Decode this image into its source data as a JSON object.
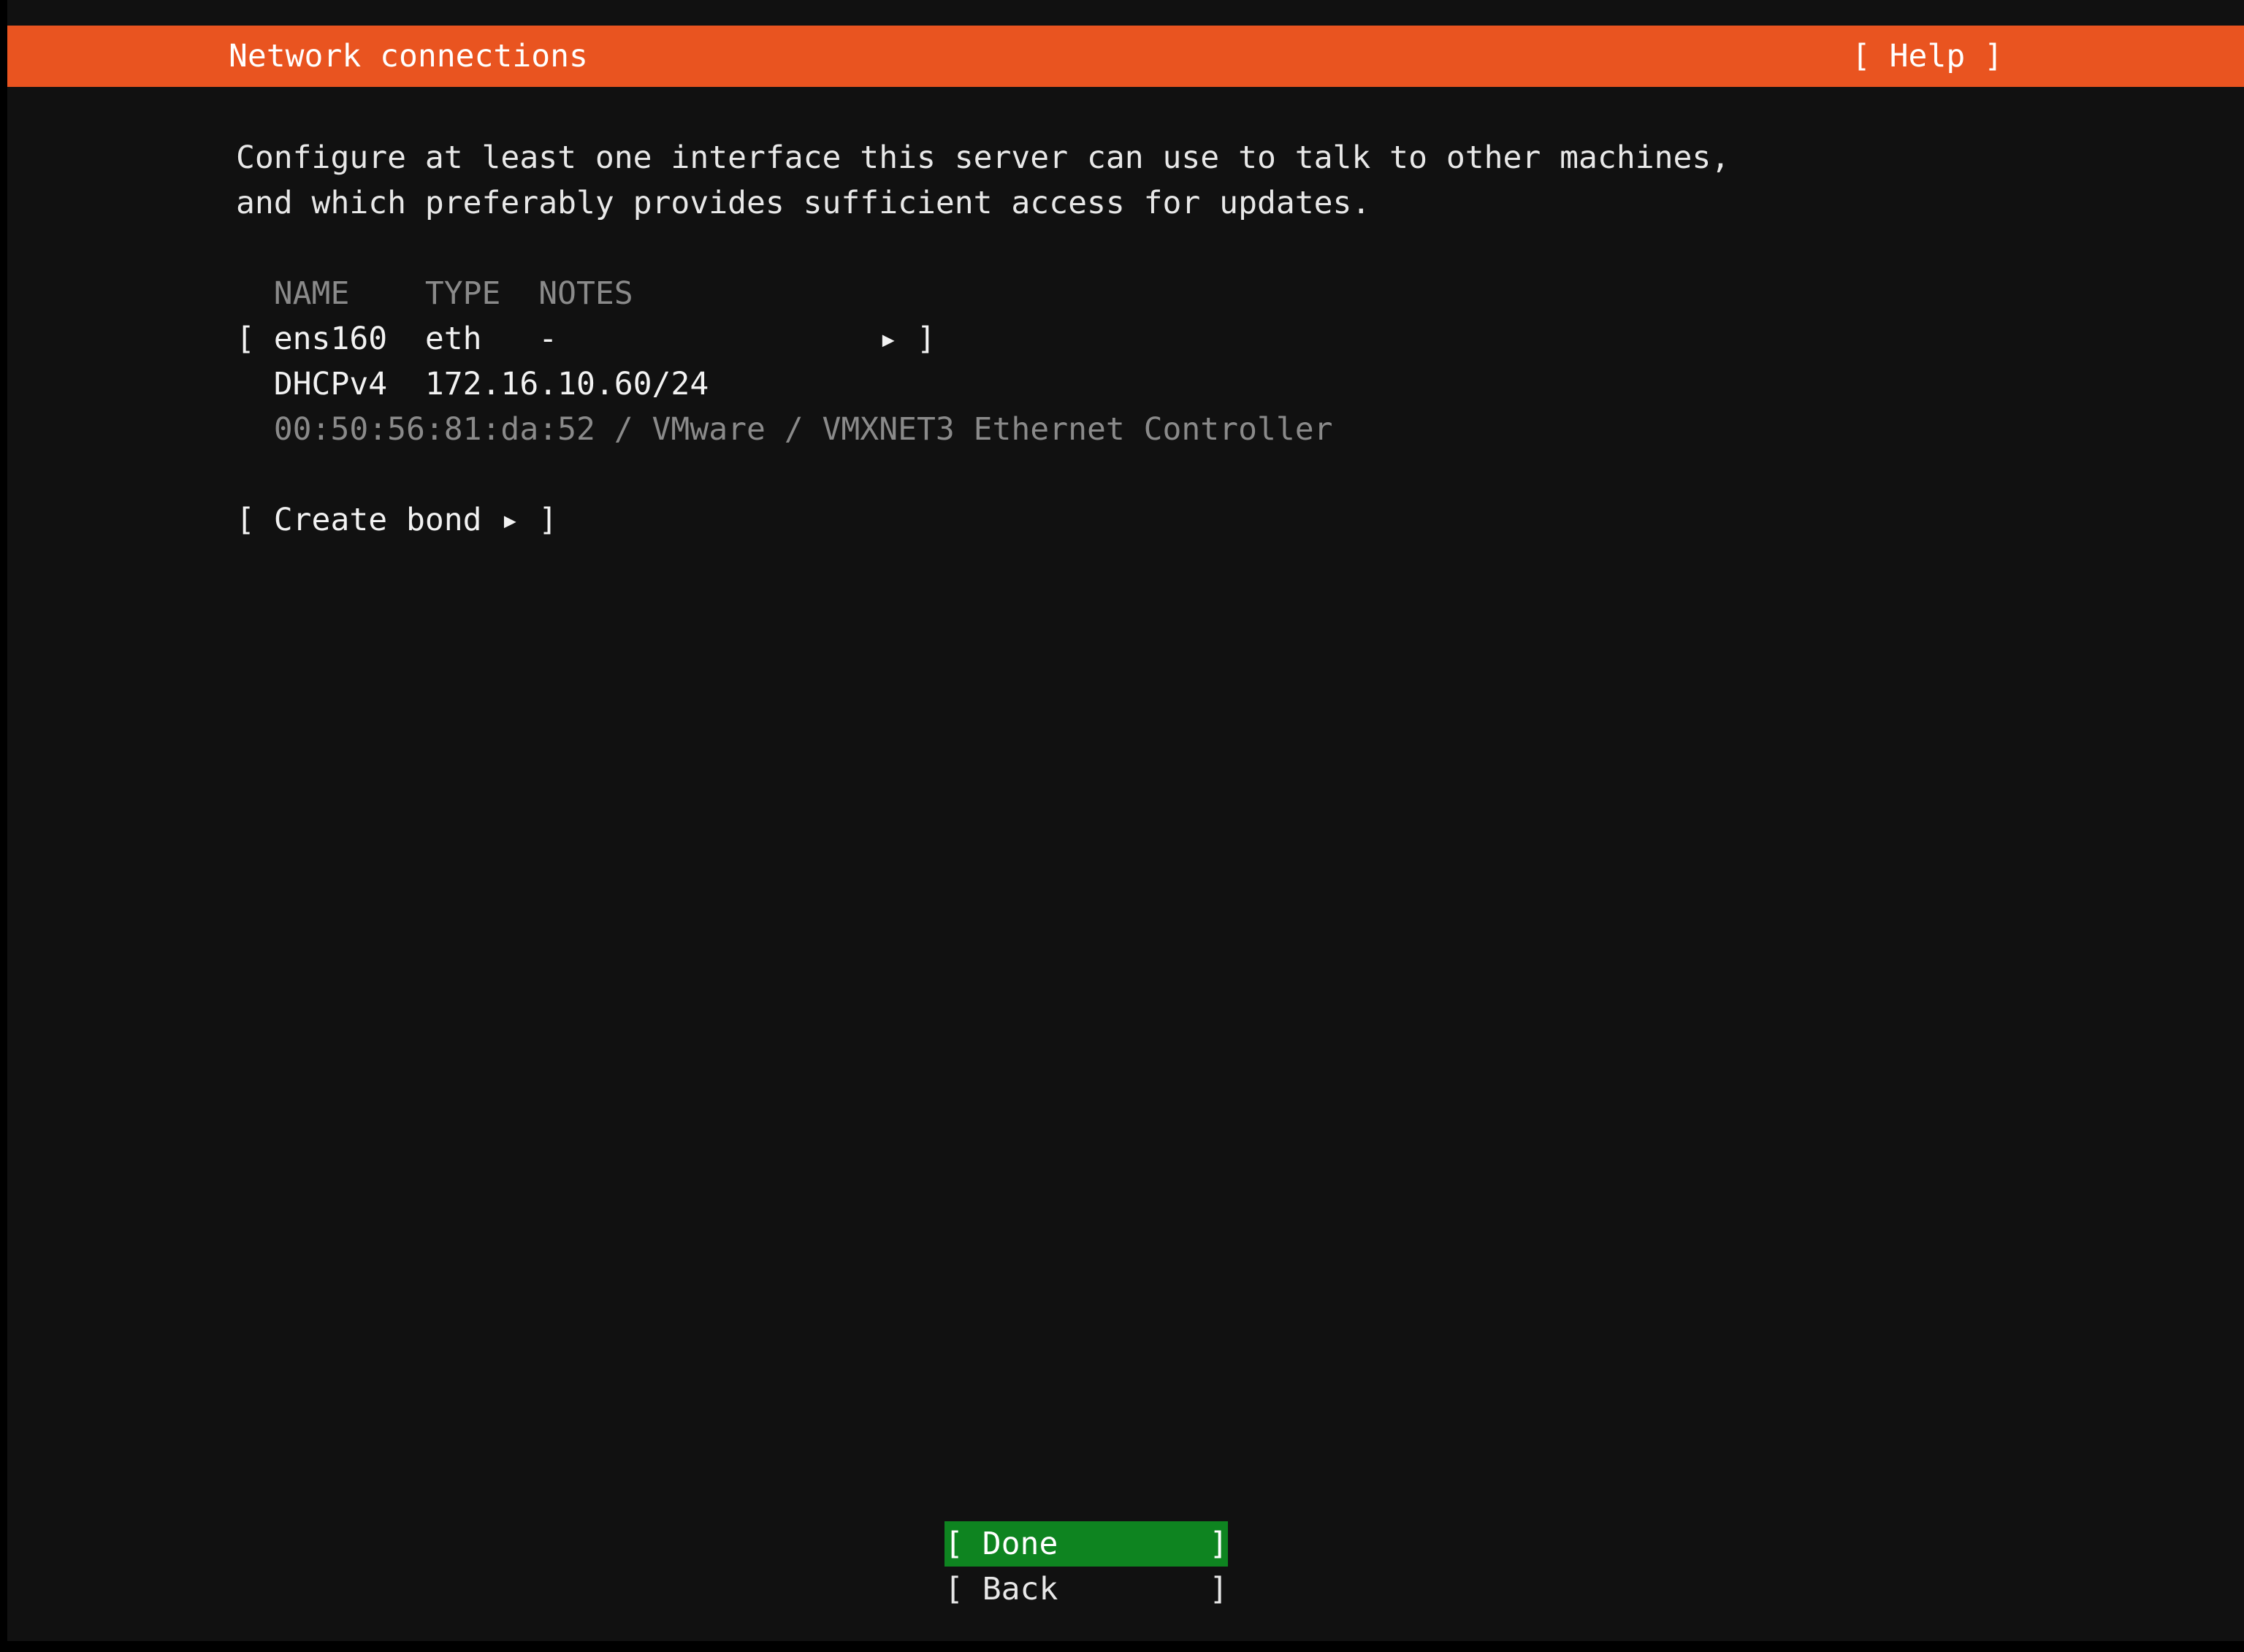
{
  "window": {
    "title": "Network connections",
    "help_label": "[ Help ]",
    "header_color": "#e95420",
    "background_color": "#111111",
    "text_color": "#e8e8e8",
    "dim_text_color": "#8a8a8a",
    "highlight_color": "#0e8420"
  },
  "description": {
    "line1": "Configure at least one interface this server can use to talk to other machines,",
    "line2": "and which preferably provides sufficient access for updates."
  },
  "table": {
    "headers": {
      "name": "NAME",
      "type": "TYPE",
      "notes": "NOTES"
    },
    "header_row_text": "  NAME    TYPE  NOTES",
    "rows": [
      {
        "selector_open": "[",
        "name": "ens160",
        "type": "eth",
        "notes": "-",
        "arrow": "▸",
        "selector_close": "]",
        "row_text": "[ ens160  eth   -                 ▸ ]",
        "detail_lines": [
          {
            "text": "  DHCPv4  172.16.10.60/24",
            "style": "bright",
            "protocol": "DHCPv4",
            "address": "172.16.10.60/24"
          },
          {
            "text": "  00:50:56:81:da:52 / VMware / VMXNET3 Ethernet Controller",
            "style": "dim",
            "mac": "00:50:56:81:da:52",
            "vendor": "VMware",
            "model": "VMXNET3 Ethernet Controller"
          }
        ]
      }
    ]
  },
  "actions": {
    "create_bond": "[ Create bond ▸ ]",
    "create_bond_label": "Create bond"
  },
  "buttons": {
    "done": "[ Done        ]",
    "done_label": "Done",
    "back": "[ Back        ]",
    "back_label": "Back"
  }
}
